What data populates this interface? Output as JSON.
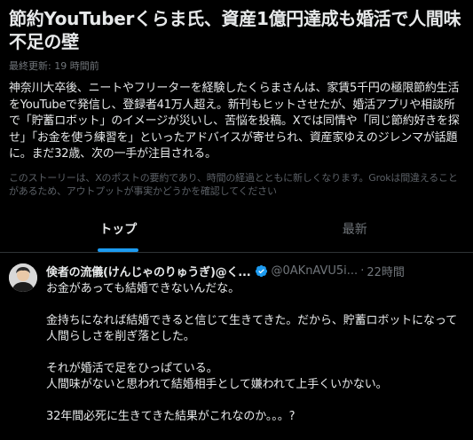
{
  "story": {
    "title": "節約YouTuberくらま氏、資産1億円達成も婚活で人間味不足の壁",
    "updated": "最終更新: 19 時間前",
    "summary": "神奈川大卒後、ニートやフリーターを経験したくらまさんは、家賃5千円の極限節約生活をYouTubeで発信し、登録者41万人超え。新刊もヒットさせたが、婚活アプリや相談所で「貯蓄ロボット」のイメージが災いし、苦悩を投稿。Xでは同情や「同じ節約好きを探せ」「お金を使う練習を」といったアドバイスが寄せられ、資産家ゆえのジレンマが話題に。まだ32歳、次の一手が注目される。",
    "disclaimer": "このストーリーは、Xのポストの要約であり、時間の経過とともに新しくなります。Grokは間違えることがあるため、アウトプットが事実かどうかを確認してください"
  },
  "tabs": [
    {
      "label": "トップ",
      "active": true
    },
    {
      "label": "最新",
      "active": false
    }
  ],
  "post": {
    "author": "倹者の流儀(けんじゃのりゅうぎ)@く...",
    "handle": "@0AKnAVU5i...",
    "separator": "·",
    "time": "22時間",
    "lines": [
      "お金があっても結婚できないんだな。",
      "",
      "金持ちになれば結婚できると信じて生きてきた。だから、貯蓄ロボットになって人間らしさを削ぎ落とした。",
      "",
      "それが婚活で足をひっぱている。",
      "人間味がないと思われて結婚相手として嫌われて上手くいかない。",
      "",
      "32年間必死に生きてきた結果がこれなのか。。。?"
    ]
  },
  "colors": {
    "background": "#000000",
    "text": "#e7e9ea",
    "muted": "#71767b",
    "accent": "#1d9bf0"
  },
  "icons": {
    "verified": "verified-badge-icon",
    "avatar": "user-avatar"
  }
}
